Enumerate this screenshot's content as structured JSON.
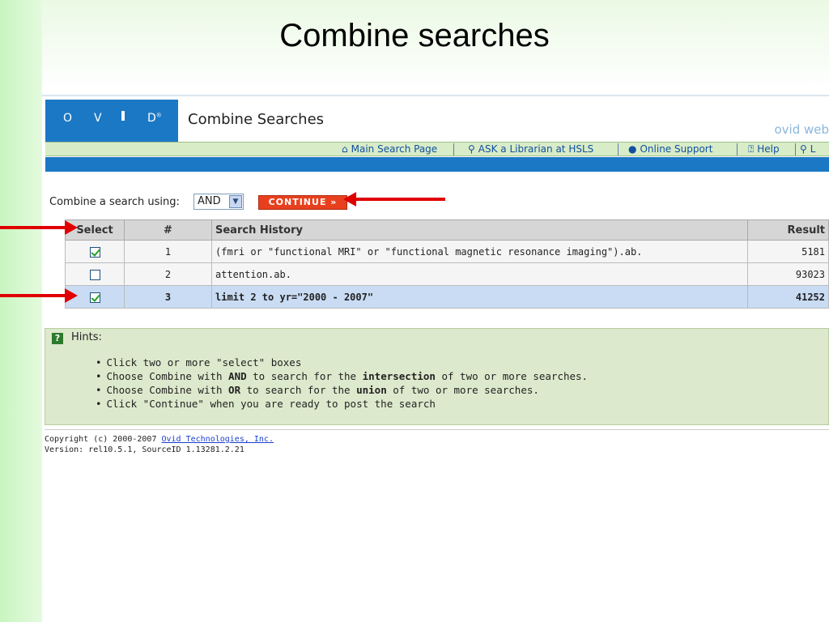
{
  "slide": {
    "title": "Combine searches"
  },
  "ovid": {
    "logo": {
      "letters": [
        "O",
        "V",
        "I",
        "D"
      ]
    },
    "page_title": "Combine Searches",
    "brand_partial": "ovid web",
    "nav": [
      {
        "label": "Main Search Page",
        "icon": "home-icon"
      },
      {
        "label": "ASK a Librarian at HSLS",
        "icon": "librarian-icon"
      },
      {
        "label": "Online Support",
        "icon": "support-icon"
      },
      {
        "label": "Help",
        "icon": "help-icon"
      },
      {
        "label": "L",
        "icon": "logoff-icon"
      }
    ]
  },
  "combine": {
    "label": "Combine a search using:",
    "operator": "AND",
    "continue_label": "CONTINUE »"
  },
  "history": {
    "columns": [
      "Select",
      "#",
      "Search History",
      "Result"
    ],
    "rows": [
      {
        "checked": true,
        "num": "1",
        "query": "(fmri or \"functional MRI\" or \"functional magnetic resonance imaging\").ab.",
        "results": "5181",
        "selected": false
      },
      {
        "checked": false,
        "num": "2",
        "query": "attention.ab.",
        "results": "93023",
        "selected": false
      },
      {
        "checked": true,
        "num": "3",
        "query": "limit 2 to yr=\"2000 - 2007\"",
        "results": "41252",
        "selected": true
      }
    ]
  },
  "hints": {
    "title": "Hints",
    "items": [
      "Click two or more \"select\" boxes",
      "Choose Combine with AND to search for the intersection of two or more searches.",
      "Choose Combine with OR to search for the union of two or more searches.",
      "Click \"Continue\" when you are ready to post the search"
    ]
  },
  "footer": {
    "copyright_prefix": "Copyright (c) 2000-2007 ",
    "company_link": "Ovid Technologies, Inc.",
    "version": "Version: rel10.5.1, SourceID 1.13281.2.21"
  },
  "colors": {
    "ovid_blue": "#1b78c5",
    "arrow_red": "#e00000",
    "continue_red": "#e8401e",
    "hints_green": "#dde9cc"
  }
}
